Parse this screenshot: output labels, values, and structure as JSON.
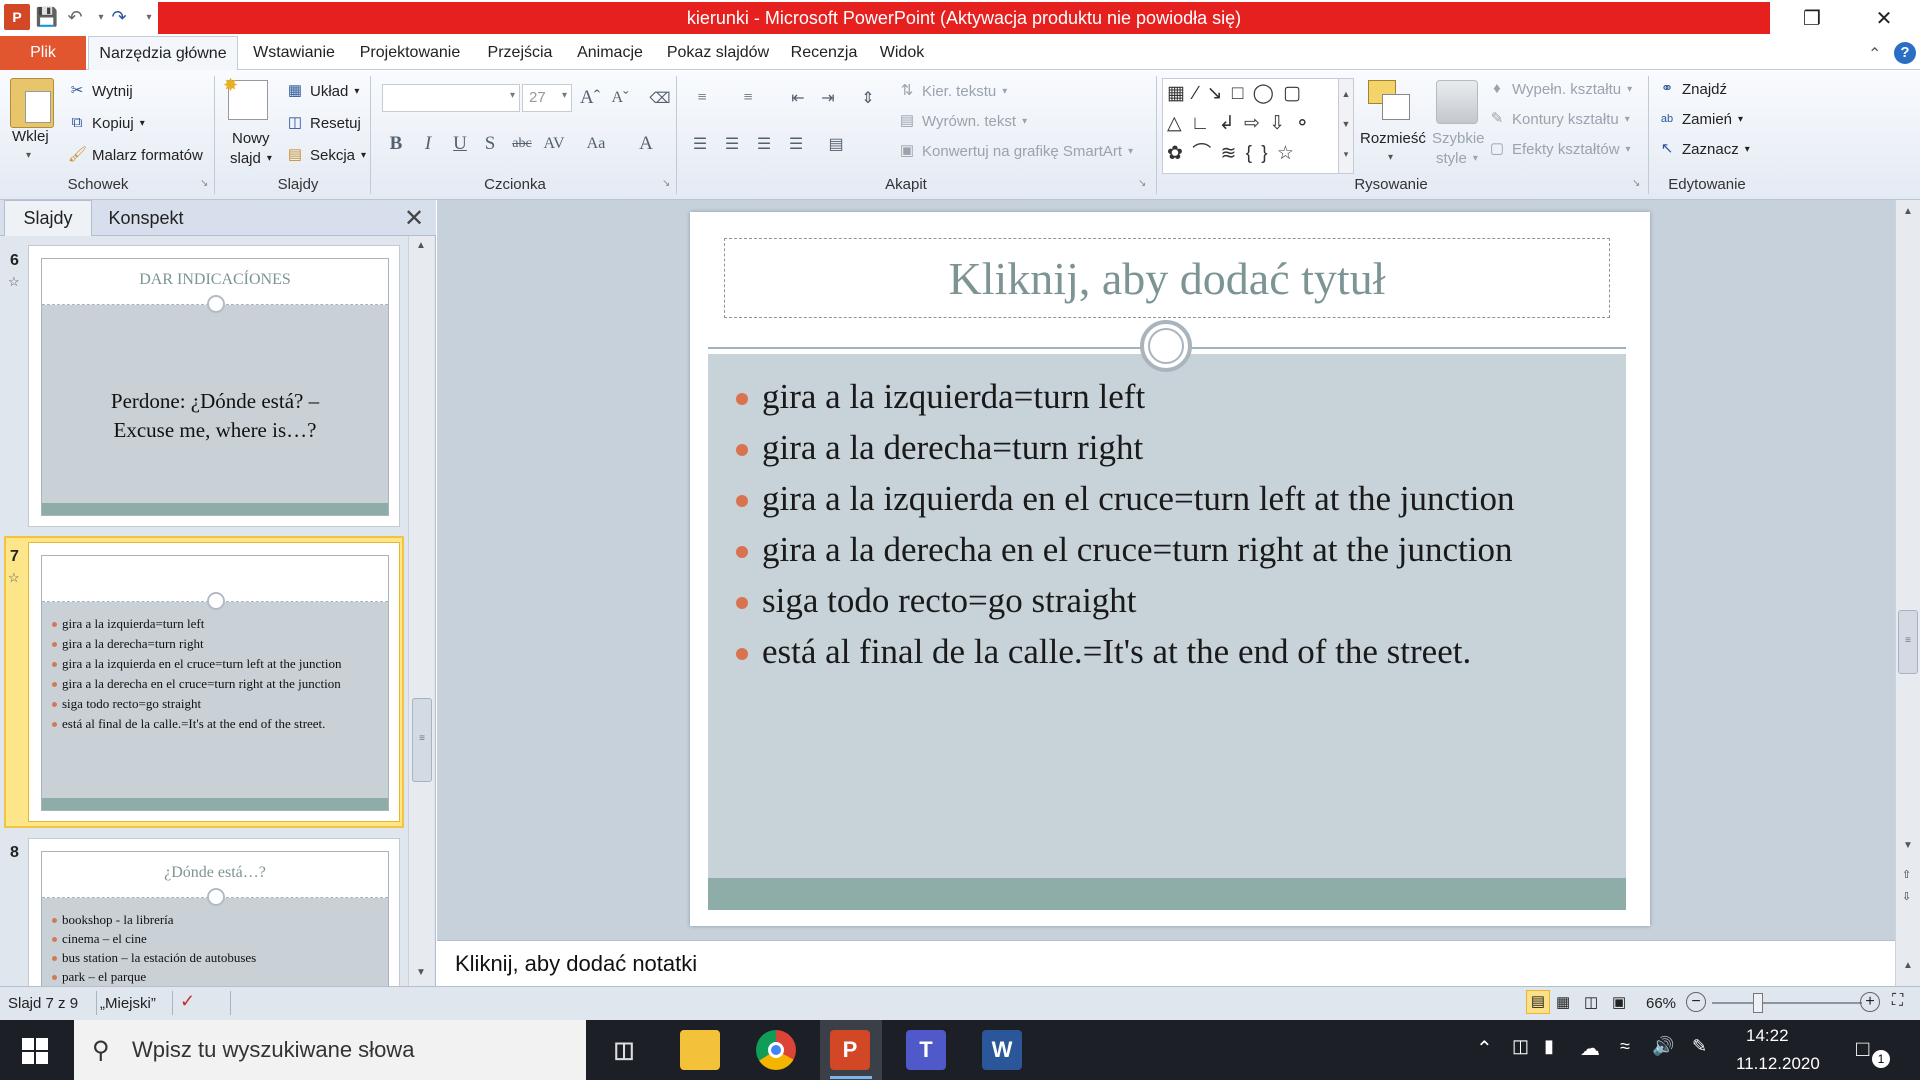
{
  "app": {
    "window_title": "kierunki - Microsoft PowerPoint (Aktywacja produktu nie powiodła się)"
  },
  "tabs": [
    "Plik",
    "Narzędzia główne",
    "Wstawianie",
    "Projektowanie",
    "Przejścia",
    "Animacje",
    "Pokaz slajdów",
    "Recenzja",
    "Widok"
  ],
  "ribbon": {
    "clipboard": {
      "paste": "Wklej",
      "cut": "Wytnij",
      "copy": "Kopiuj",
      "format_painter": "Malarz formatów",
      "label": "Schowek"
    },
    "slides": {
      "new_slide_1": "Nowy",
      "new_slide_2": "slajd",
      "layout": "Układ",
      "reset": "Resetuj",
      "section": "Sekcja",
      "label": "Slajdy"
    },
    "font": {
      "size": "27",
      "label": "Czcionka"
    },
    "paragraph": {
      "text_direction": "Kier. tekstu",
      "align_text": "Wyrówn. tekst",
      "smartart": "Konwertuj na grafikę SmartArt",
      "label": "Akapit"
    },
    "drawing": {
      "arrange": "Rozmieść",
      "quick_styles_1": "Szybkie",
      "quick_styles_2": "style",
      "fill": "Wypełn. kształtu",
      "outline": "Kontury kształtu",
      "effects": "Efekty kształtów",
      "label": "Rysowanie"
    },
    "editing": {
      "find": "Znajdź",
      "replace": "Zamień",
      "select": "Zaznacz",
      "label": "Edytowanie"
    }
  },
  "pane": {
    "tab_slides": "Slajdy",
    "tab_outline": "Konspekt"
  },
  "thumbnails": {
    "s6": {
      "num": "6",
      "title": "DAR INDICACÍONES",
      "body_1": "Perdone: ¿Dónde está? –",
      "body_2": "Excuse me, where is…?"
    },
    "s7": {
      "num": "7",
      "items": [
        "gira a la izquierda=turn left",
        "gira a la derecha=turn right",
        "gira a la izquierda en el cruce=turn left at the junction",
        "gira a la derecha en el cruce=turn right at the junction",
        "siga todo recto=go straight",
        "está al final de la calle.=It's at the end of the street."
      ]
    },
    "s8": {
      "num": "8",
      "title": "¿Dónde está…?",
      "items": [
        "bookshop - la librería",
        "cinema – el cine",
        "bus station – la estación de autobuses",
        "park – el parque"
      ]
    }
  },
  "slide": {
    "title_placeholder": "Kliknij, aby dodać tytuł",
    "bullets": [
      "gira a la izquierda=turn left",
      "gira a la derecha=turn right",
      "gira a la izquierda en el cruce=turn left at the junction",
      "gira a la derecha en el cruce=turn right at the junction",
      "siga todo recto=go straight",
      "está al final de la calle.=It's at the end of the street."
    ]
  },
  "notes": {
    "placeholder": "Kliknij, aby dodać notatki"
  },
  "status": {
    "slide_info": "Slajd 7 z 9",
    "theme": "„Miejski”",
    "zoom": "66%"
  },
  "taskbar": {
    "search_placeholder": "Wpisz tu wyszukiwane słowa",
    "time": "14:22",
    "date": "11.12.2020",
    "notif_count": "1"
  }
}
